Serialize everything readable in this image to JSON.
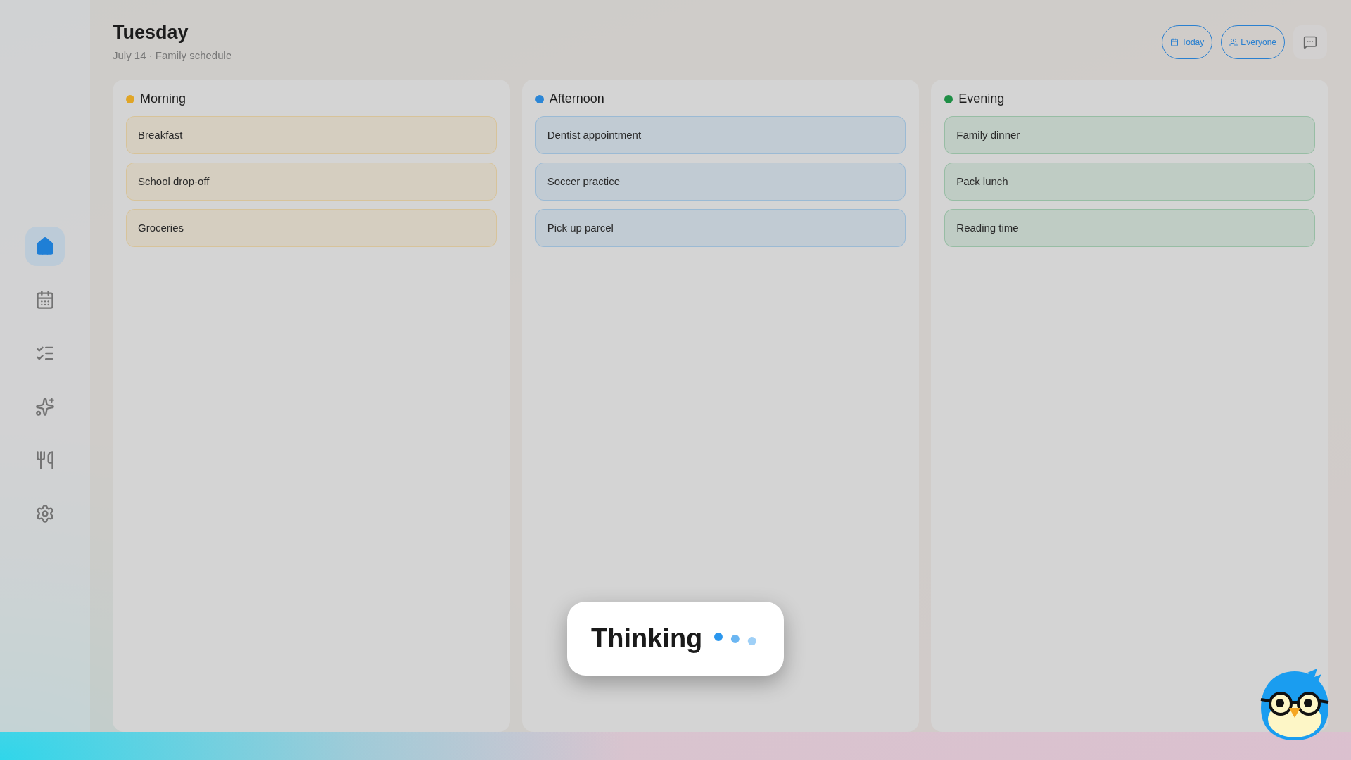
{
  "sidebar": {
    "items": [
      {
        "selected": true
      },
      {
        "selected": false
      },
      {
        "selected": false
      },
      {
        "selected": false
      },
      {
        "selected": false
      },
      {
        "selected": false
      }
    ]
  },
  "header": {
    "title": "Tuesday",
    "subtitle": "July 14 · Family schedule",
    "buttons": [
      "Today",
      "Everyone"
    ]
  },
  "columns": [
    {
      "title": "Morning",
      "color": "#e0a526",
      "cards": [
        "Breakfast",
        "School drop-off",
        "Groceries"
      ]
    },
    {
      "title": "Afternoon",
      "color": "#2b86d6",
      "cards": [
        "Dentist appointment",
        "Soccer practice",
        "Pick up parcel"
      ]
    },
    {
      "title": "Evening",
      "color": "#1e8e45",
      "cards": [
        "Family dinner",
        "Pack lunch",
        "Reading time"
      ]
    }
  ],
  "status": {
    "text": "Thinking"
  }
}
